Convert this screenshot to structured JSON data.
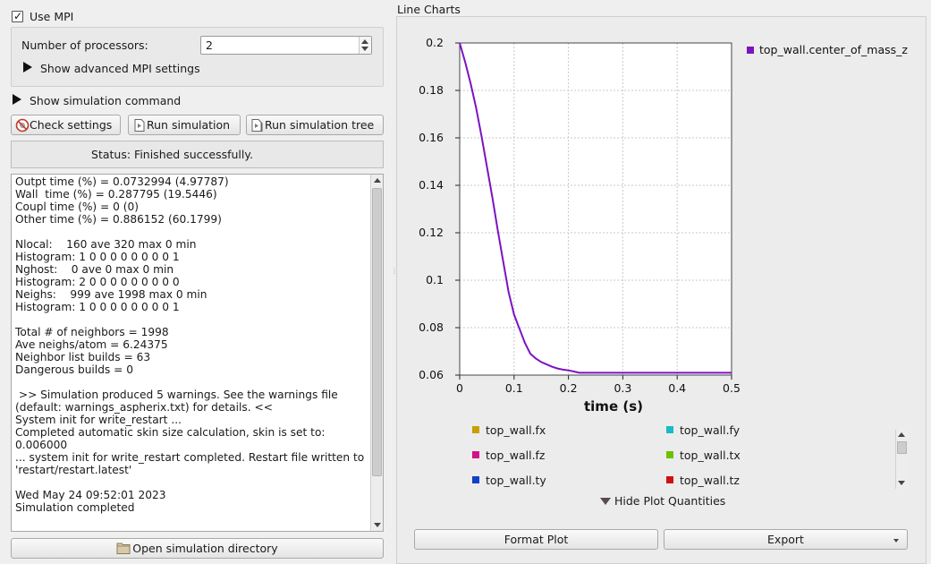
{
  "mpi": {
    "use_mpi_label": "Use MPI",
    "use_mpi_checked": true,
    "processors_label": "Number of processors:",
    "processors_value": "2",
    "advanced_label": "Show advanced MPI settings"
  },
  "simulation": {
    "show_command_label": "Show simulation command",
    "check_settings_label": "Check settings",
    "run_simulation_label": "Run simulation",
    "run_tree_label": "Run simulation tree",
    "status_text": "Status: Finished successfully.",
    "open_dir_label": "Open simulation directory",
    "log_text": "Outpt time (%) = 0.0732994 (4.97787)\nWall  time (%) = 0.287795 (19.5446)\nCoupl time (%) = 0 (0)\nOther time (%) = 0.886152 (60.1799)\n\nNlocal:    160 ave 320 max 0 min\nHistogram: 1 0 0 0 0 0 0 0 0 1\nNghost:    0 ave 0 max 0 min\nHistogram: 2 0 0 0 0 0 0 0 0 0\nNeighs:    999 ave 1998 max 0 min\nHistogram: 1 0 0 0 0 0 0 0 0 1\n\nTotal # of neighbors = 1998\nAve neighs/atom = 6.24375\nNeighbor list builds = 63\nDangerous builds = 0\n\n >> Simulation produced 5 warnings. See the warnings file (default: warnings_aspherix.txt) for details. <<\nSystem init for write_restart ...\nCompleted automatic skin size calculation, skin is set to: 0.006000\n... system init for write_restart completed. Restart file written to 'restart/restart.latest'\n\nWed May 24 09:52:01 2023\nSimulation completed"
  },
  "charts": {
    "section_title": "Line Charts",
    "hide_quantities_label": "Hide Plot Quantities",
    "format_plot_label": "Format Plot",
    "export_label": "Export",
    "quantities": [
      {
        "name": "top_wall.fx",
        "color": "#c8a000"
      },
      {
        "name": "top_wall.fy",
        "color": "#17bcc8"
      },
      {
        "name": "top_wall.fz",
        "color": "#d0138a"
      },
      {
        "name": "top_wall.tx",
        "color": "#6ec000"
      },
      {
        "name": "top_wall.ty",
        "color": "#1040c8"
      },
      {
        "name": "top_wall.tz",
        "color": "#d01010"
      }
    ]
  },
  "chart_data": {
    "type": "line",
    "title": "",
    "xlabel": "time (s)",
    "ylabel": "",
    "xlim": [
      0,
      0.5
    ],
    "ylim": [
      0.06,
      0.2
    ],
    "xticks": [
      "0",
      "0.1",
      "0.2",
      "0.3",
      "0.4",
      "0.5"
    ],
    "yticks": [
      "0.06",
      "0.08",
      "0.1",
      "0.12",
      "0.14",
      "0.16",
      "0.18",
      "0.2"
    ],
    "grid": true,
    "legend_position": "right",
    "series": [
      {
        "name": "top_wall.center_of_mass_z",
        "color": "#7d12c2",
        "x": [
          0,
          0.01,
          0.02,
          0.03,
          0.04,
          0.05,
          0.06,
          0.07,
          0.08,
          0.09,
          0.1,
          0.11,
          0.12,
          0.13,
          0.14,
          0.15,
          0.16,
          0.17,
          0.18,
          0.19,
          0.2,
          0.21,
          0.22,
          0.25,
          0.3,
          0.35,
          0.4,
          0.45,
          0.5
        ],
        "y": [
          0.2,
          0.192,
          0.183,
          0.173,
          0.161,
          0.148,
          0.135,
          0.121,
          0.108,
          0.095,
          0.0855,
          0.0795,
          0.0735,
          0.069,
          0.067,
          0.0655,
          0.0645,
          0.0635,
          0.0628,
          0.0623,
          0.062,
          0.0615,
          0.061,
          0.061,
          0.061,
          0.061,
          0.061,
          0.061,
          0.061
        ]
      }
    ]
  }
}
